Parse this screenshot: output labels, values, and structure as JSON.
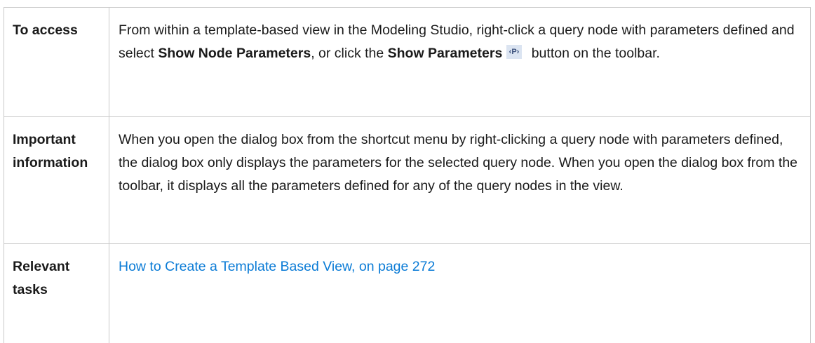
{
  "rows": {
    "access": {
      "label": "To access",
      "text_1": "From within a template-based view in the Modeling Studio, right-click a query node with parameters defined and select ",
      "bold_1": "Show Node Parameters",
      "text_2": ", or click the ",
      "bold_2": "Show Parameters",
      "icon": "show-parameters-icon",
      "text_3": " button on the toolbar."
    },
    "important": {
      "label_line1": "Important",
      "label_line2": "information",
      "text": "When you open the dialog box from the shortcut menu by right-clicking a query node with parameters defined, the dialog box only displays the parameters for the selected query node. When you open the dialog box from the toolbar, it displays all the parameters defined for any of the query nodes in the view."
    },
    "tasks": {
      "label_line1": "Relevant",
      "label_line2": "tasks",
      "link_text": "How to Create a Template Based View, on page 272"
    }
  },
  "colors": {
    "link": "#0a7bd6",
    "border": "#c9c9c9"
  }
}
